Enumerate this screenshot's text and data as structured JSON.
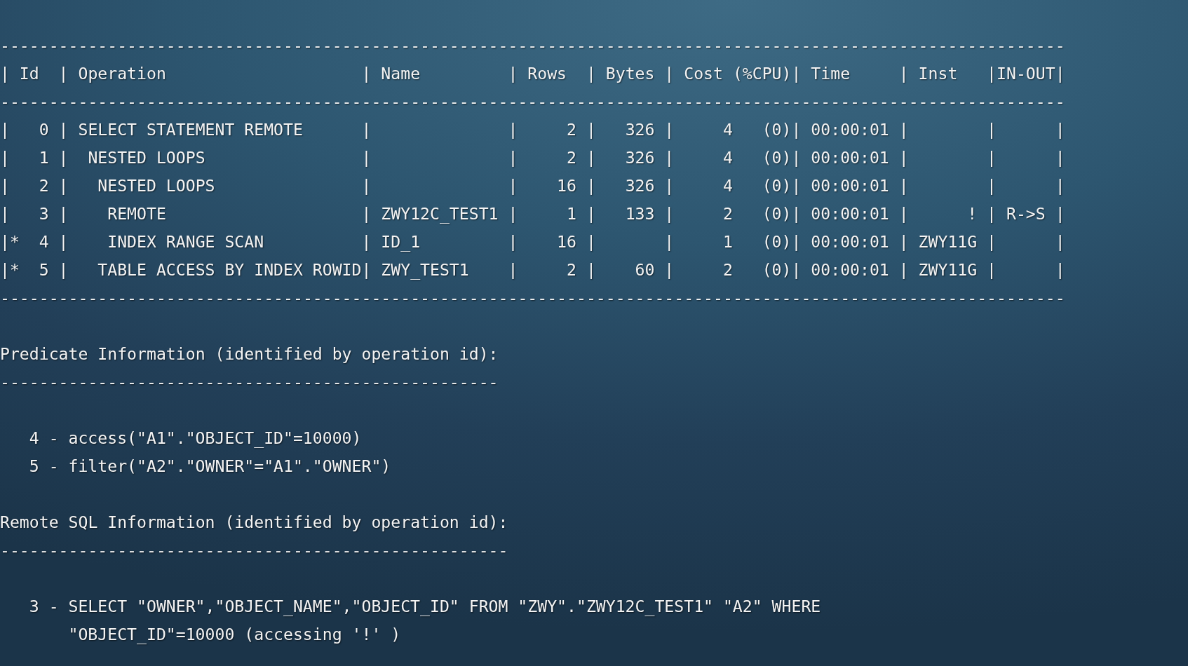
{
  "plan_table": {
    "top_rule": "-------------------------------------------------------------------------------------------------------------",
    "header": "| Id  | Operation                    | Name         | Rows  | Bytes | Cost (%CPU)| Time     | Inst   |IN-OUT|",
    "header_rule": "-------------------------------------------------------------------------------------------------------------",
    "rows": [
      "|   0 | SELECT STATEMENT REMOTE      |              |     2 |   326 |     4   (0)| 00:00:01 |        |      |",
      "|   1 |  NESTED LOOPS                |              |     2 |   326 |     4   (0)| 00:00:01 |        |      |",
      "|   2 |   NESTED LOOPS               |              |    16 |   326 |     4   (0)| 00:00:01 |        |      |",
      "|   3 |    REMOTE                    | ZWY12C_TEST1 |     1 |   133 |     2   (0)| 00:00:01 |      ! | R->S |",
      "|*  4 |    INDEX RANGE SCAN          | ID_1         |    16 |       |     1   (0)| 00:00:01 | ZWY11G |      |",
      "|*  5 |   TABLE ACCESS BY INDEX ROWID| ZWY_TEST1    |     2 |    60 |     2   (0)| 00:00:01 | ZWY11G |      |"
    ],
    "bottom_rule": "-------------------------------------------------------------------------------------------------------------"
  },
  "predicate_information": {
    "title": "Predicate Information (identified by operation id):",
    "rule": "---------------------------------------------------",
    "lines": [
      "4 - access(\"A1\".\"OBJECT_ID\"=10000)",
      "5 - filter(\"A2\".\"OWNER\"=\"A1\".\"OWNER\")"
    ]
  },
  "remote_sql_information": {
    "title": "Remote SQL Information (identified by operation id):",
    "rule": "----------------------------------------------------",
    "lines": [
      "3 - SELECT \"OWNER\",\"OBJECT_NAME\",\"OBJECT_ID\" FROM \"ZWY\".\"ZWY12C_TEST1\" \"A2\" WHERE \"OBJECT_ID\"=10000 (accessing '!' )"
    ]
  }
}
